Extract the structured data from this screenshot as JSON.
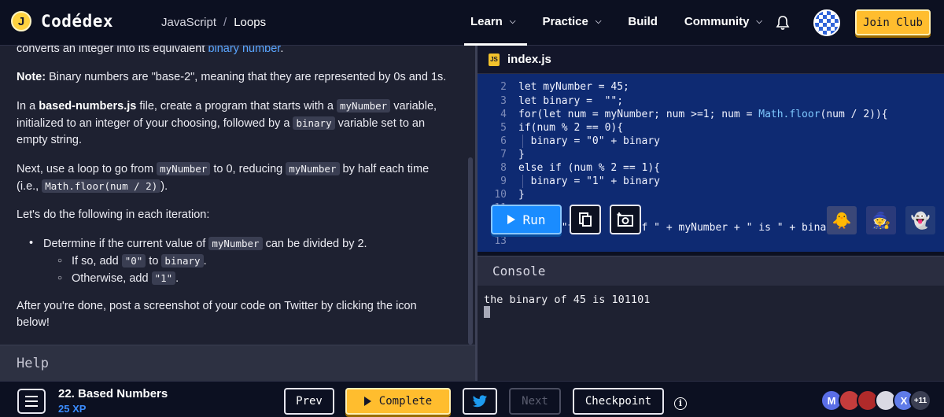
{
  "header": {
    "logo_letter": "J",
    "logo_text": "Codédex",
    "breadcrumb": [
      "JavaScript",
      "Loops"
    ],
    "breadcrumb_sep": "/",
    "nav": [
      {
        "label": "Learn",
        "chevron": true
      },
      {
        "label": "Practice",
        "chevron": true
      },
      {
        "label": "Build",
        "chevron": false
      },
      {
        "label": "Community",
        "chevron": true
      }
    ],
    "join_label": "Join Club"
  },
  "lesson": {
    "top_fragment": "converts an integer into its equivalent",
    "top_link": "binary number",
    "top_end": ".",
    "note_label": "Note:",
    "note_text": "Binary numbers are \"base-2\", meaning that they are represented by 0s and 1s.",
    "p2_a": "In a",
    "p2_file": "based-numbers.js",
    "p2_b": "file, create a program that starts with a",
    "p2_code1": "myNumber",
    "p2_c": "variable, initialized to an integer of your choosing, followed by a",
    "p2_code2": "binary",
    "p2_d": "variable set to an empty string.",
    "p3_a": "Next, use a loop to go from",
    "p3_code1": "myNumber",
    "p3_b": "to 0, reducing",
    "p3_code2": "myNumber",
    "p3_c": "by half each time (i.e.,",
    "p3_code3": "Math.floor(num / 2)",
    "p3_d": ").",
    "p4": "Let's do the following in each iteration:",
    "b1_a": "Determine if the current value of",
    "b1_code": "myNumber",
    "b1_b": "can be divided by 2.",
    "s1_a": "If so, add",
    "s1_code1": "\"0\"",
    "s1_b": "to",
    "s1_code2": "binary",
    "s1_c": ".",
    "s2_a": "Otherwise, add",
    "s2_code": "\"1\"",
    "s2_b": ".",
    "p5": "After you're done, post a screenshot of your code on Twitter by clicking the icon below!",
    "help_label": "Help"
  },
  "editor": {
    "filename": "index.js",
    "js_icon_text": "JS",
    "lines": [
      {
        "n": "2",
        "code": "let myNumber = 45;"
      },
      {
        "n": "3",
        "code": "let binary =  \"\";"
      },
      {
        "n": "4",
        "code": "for(let num = myNumber; num >=1; num = Math.floor(num / 2)){"
      },
      {
        "n": "5",
        "code": "if(num % 2 == 0){"
      },
      {
        "n": "6",
        "code": "  binary = \"0\" + binary"
      },
      {
        "n": "7",
        "code": "}"
      },
      {
        "n": "8",
        "code": "else if (num % 2 == 1){"
      },
      {
        "n": "9",
        "code": "  binary = \"1\" + binary"
      },
      {
        "n": "10",
        "code": "}"
      },
      {
        "n": "11",
        "code": ""
      },
      {
        "n": "12",
        "code": "   ...(\"th     ary of \" + myNumber + \" is \" + binary)"
      },
      {
        "n": "13",
        "code": ""
      }
    ],
    "run_label": "Run"
  },
  "console": {
    "title": "Console",
    "output": "the binary of 45 is 101101"
  },
  "footer": {
    "lesson_title": "22. Based Numbers",
    "xp": "25 XP",
    "prev_label": "Prev",
    "complete_label": "Complete",
    "next_label": "Next",
    "checkpoint_label": "Checkpoint",
    "info_label": "i",
    "avatars": [
      "M",
      "",
      "",
      "",
      "X"
    ],
    "avatar_colors": [
      "#5a6ee6",
      "#c43c3c",
      "#b02a2a",
      "#d9d9e3",
      "#5f7be8"
    ],
    "more_count": "+11"
  },
  "colors": {
    "accent_yellow": "#ffbd2e",
    "run_blue": "#1a8cff",
    "editor_bg": "#0e2a72",
    "link_blue": "#5aa5ff"
  }
}
